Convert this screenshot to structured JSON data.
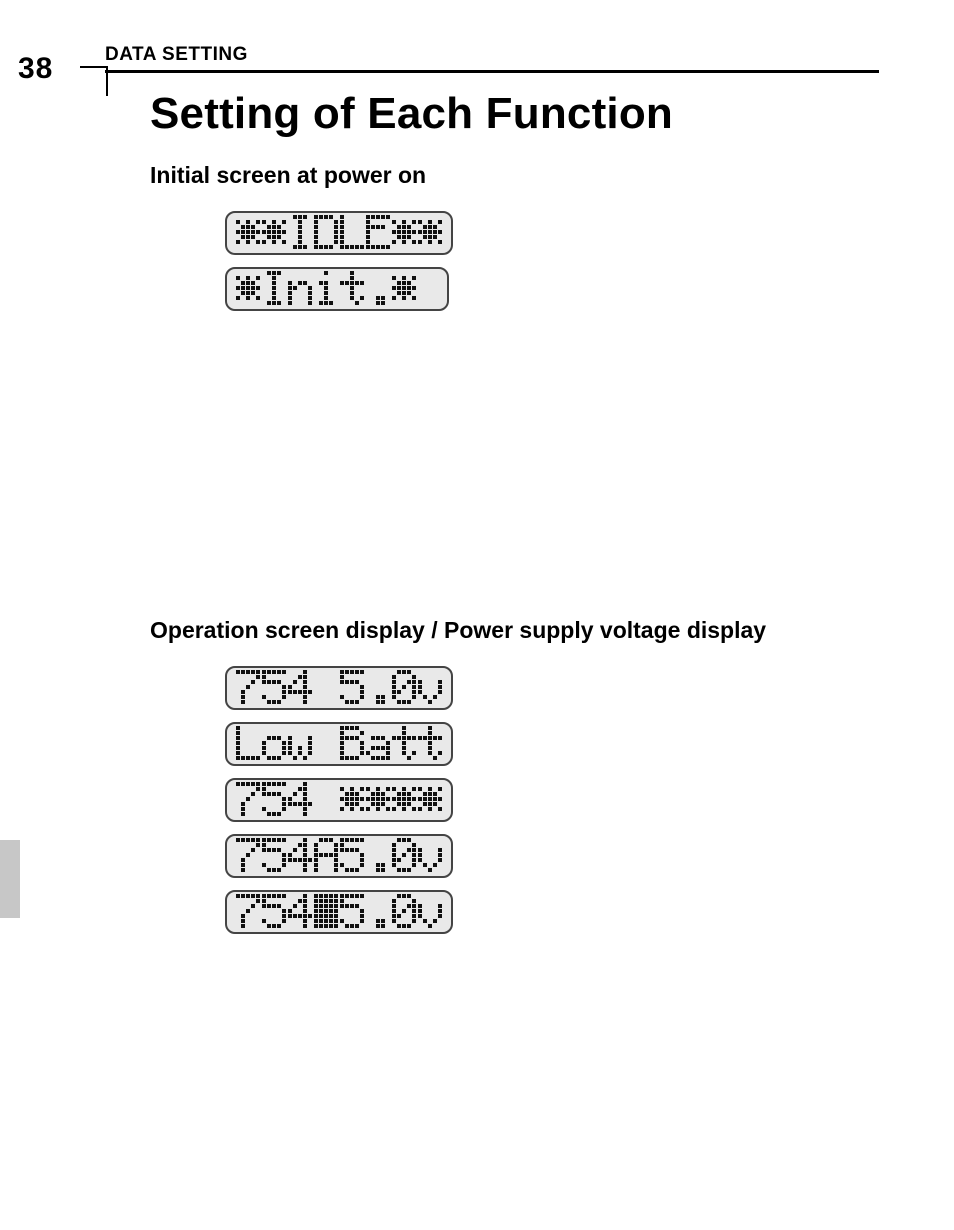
{
  "page_number": "38",
  "section_label": "DATA SETTING",
  "title": "Setting of Each Function",
  "subhead1": "Initial screen at power on",
  "subhead2": "Operation screen display / Power supply voltage display",
  "lcd_group1": [
    "**IDLE**",
    "*Init.*"
  ],
  "lcd_group2": [
    "754 5.0v",
    "Low Batt",
    "754 ****",
    "754A5.0v",
    "754#5.0v"
  ]
}
